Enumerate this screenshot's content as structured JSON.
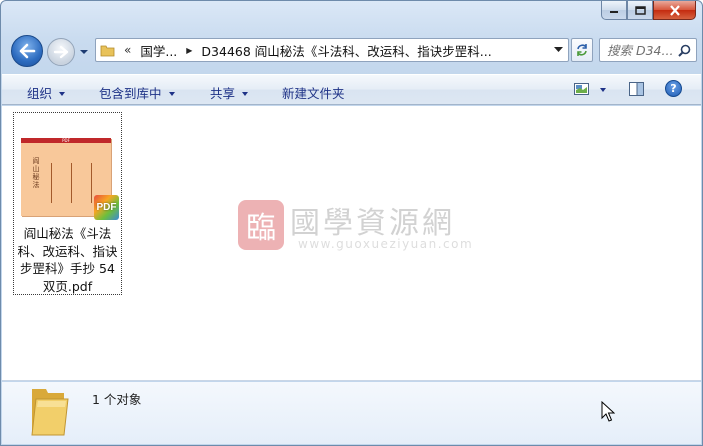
{
  "window": {
    "caption_buttons": [
      "minimize",
      "maximize",
      "close"
    ]
  },
  "address_bar": {
    "overflow_chevron": "«",
    "crumbs": [
      "国学...",
      "D34468 阎山秘法《斗法科、改运科、指诀步罡科..."
    ],
    "search_placeholder": "搜索 D34..."
  },
  "toolbar": {
    "organize": "组织",
    "include_in_library": "包含到库中",
    "share": "共享",
    "new_folder": "新建文件夹"
  },
  "files": [
    {
      "name": "阎山秘法《斗法科、改运科、指诀步罡科》手抄 54双页.pdf",
      "thumbnail_title": "阎山秘法",
      "badge": "PDF",
      "header_label": "PDF"
    }
  ],
  "watermark": {
    "seal_char": "臨",
    "title": "國學資源網",
    "url": "www.guoxueziyuan.com"
  },
  "details": {
    "item_count": "1 个对象"
  },
  "colors": {
    "window_frame": "#c2d6ec",
    "close_button": "#c42b0f",
    "link_text": "#1e3287",
    "thumbnail_bg": "#f8c89a"
  },
  "icons": [
    "back-arrow-icon",
    "forward-arrow-icon",
    "folder-icon",
    "refresh-icon",
    "search-icon",
    "view-icon",
    "preview-pane-icon",
    "help-icon",
    "pdf-icon",
    "cursor-icon"
  ]
}
